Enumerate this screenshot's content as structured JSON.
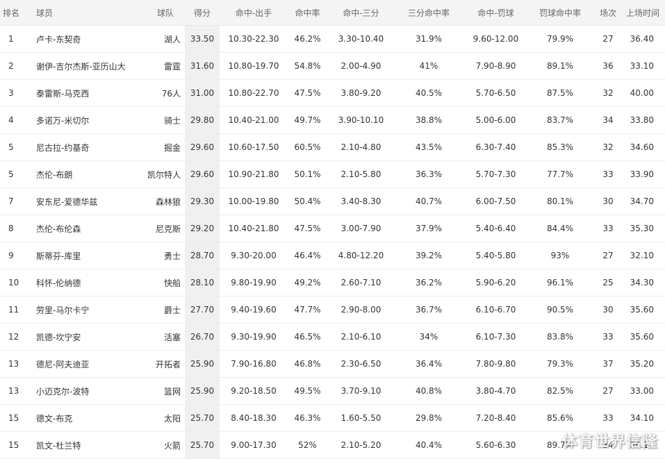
{
  "table": {
    "headers": [
      "排名",
      "球员",
      "球队",
      "得分",
      "命中-出手",
      "命中率",
      "命中-三分",
      "三分命中率",
      "命中-罚球",
      "罚球命中率",
      "场次",
      "上场时间"
    ],
    "rows": [
      [
        "1",
        "卢卡-东契奇",
        "湖人",
        "33.50",
        "10.30-22.30",
        "46.2%",
        "3.30-10.40",
        "31.9%",
        "9.60-12.00",
        "79.9%",
        "27",
        "36.40"
      ],
      [
        "2",
        "谢伊-吉尔杰斯-亚历山大",
        "雷霆",
        "31.60",
        "10.80-19.70",
        "54.8%",
        "2.00-4.90",
        "41%",
        "7.90-8.90",
        "89.1%",
        "36",
        "33.10"
      ],
      [
        "3",
        "泰雷斯-马克西",
        "76人",
        "31.00",
        "10.80-22.70",
        "47.5%",
        "3.80-9.20",
        "40.5%",
        "5.70-6.50",
        "87.5%",
        "32",
        "40.00"
      ],
      [
        "4",
        "多诺万-米切尔",
        "骑士",
        "29.80",
        "10.40-21.00",
        "49.7%",
        "3.90-10.10",
        "38.8%",
        "5.00-6.00",
        "83.7%",
        "34",
        "33.80"
      ],
      [
        "5",
        "尼古拉-约基奇",
        "掘金",
        "29.60",
        "10.60-17.50",
        "60.5%",
        "2.10-4.80",
        "43.5%",
        "6.30-7.40",
        "85.3%",
        "32",
        "34.60"
      ],
      [
        "5",
        "杰伦-布朗",
        "凯尔特人",
        "29.60",
        "10.90-21.80",
        "50.1%",
        "2.10-5.80",
        "36.3%",
        "5.70-7.30",
        "77.7%",
        "33",
        "33.90"
      ],
      [
        "7",
        "安东尼-爱德华兹",
        "森林狼",
        "29.30",
        "10.00-19.80",
        "50.4%",
        "3.40-8.30",
        "40.7%",
        "6.00-7.50",
        "80.1%",
        "30",
        "34.70"
      ],
      [
        "8",
        "杰伦-布伦森",
        "尼克斯",
        "29.20",
        "10.40-21.80",
        "47.5%",
        "3.00-7.90",
        "37.9%",
        "5.40-6.40",
        "84.4%",
        "33",
        "35.30"
      ],
      [
        "9",
        "斯蒂芬-库里",
        "勇士",
        "28.70",
        "9.30-20.00",
        "46.4%",
        "4.80-12.20",
        "39.2%",
        "5.40-5.80",
        "93%",
        "27",
        "32.10"
      ],
      [
        "10",
        "科怀-伦纳德",
        "快船",
        "28.10",
        "9.80-19.90",
        "49.2%",
        "2.60-7.10",
        "36.2%",
        "5.90-6.20",
        "96.1%",
        "25",
        "34.30"
      ],
      [
        "11",
        "劳里-马尔卡宁",
        "爵士",
        "27.70",
        "9.40-19.60",
        "47.7%",
        "2.90-8.00",
        "36.7%",
        "6.10-6.70",
        "90.5%",
        "30",
        "35.60"
      ],
      [
        "12",
        "凯德-坎宁安",
        "活塞",
        "26.70",
        "9.30-19.90",
        "46.5%",
        "2.10-6.10",
        "34%",
        "6.10-7.30",
        "83.8%",
        "33",
        "35.60"
      ],
      [
        "13",
        "德尼-阿夫迪亚",
        "开拓者",
        "25.90",
        "7.90-16.80",
        "46.8%",
        "2.30-6.50",
        "36.4%",
        "7.80-9.80",
        "79.3%",
        "37",
        "35.20"
      ],
      [
        "13",
        "小迈克尔-波特",
        "篮网",
        "25.90",
        "9.20-18.50",
        "49.5%",
        "3.70-9.10",
        "40.8%",
        "3.80-4.70",
        "82.5%",
        "27",
        "33.00"
      ],
      [
        "15",
        "德文-布克",
        "太阳",
        "25.70",
        "8.40-18.30",
        "46.3%",
        "1.60-5.50",
        "29.8%",
        "7.20-8.40",
        "85.6%",
        "33",
        "34.10"
      ],
      [
        "15",
        "凯文-杜兰特",
        "火箭",
        "25.70",
        "9.00-17.30",
        "52%",
        "2.10-5.20",
        "40.4%",
        "5.60-6.30",
        "89.7%",
        "34",
        "36.10"
      ]
    ]
  },
  "watermark": "体育世界信隆"
}
